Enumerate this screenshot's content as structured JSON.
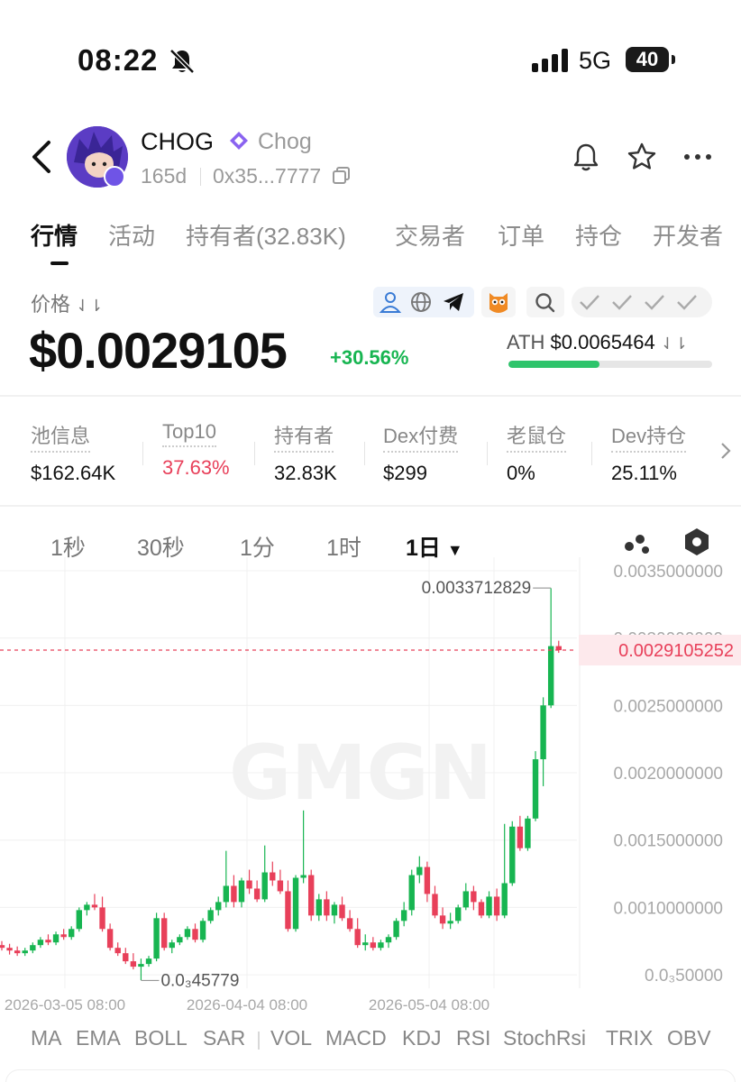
{
  "status_bar": {
    "time": "08:22",
    "network": "5G",
    "battery": "40"
  },
  "header": {
    "symbol": "CHOG",
    "name": "Chog",
    "age": "165d",
    "address": "0x35...7777",
    "icons": [
      "back-icon",
      "bell-icon",
      "star-icon",
      "more-icon",
      "copy-icon",
      "verified-icon"
    ]
  },
  "tabs": [
    "行情",
    "活动",
    "持有者(32.83K)",
    "交易者",
    "订单",
    "持仓",
    "开发者"
  ],
  "price_section": {
    "label": "价格",
    "price": "$0.0029105",
    "change": "+30.56%",
    "ath_label": "ATH",
    "ath_value": "$0.0065464",
    "ath_progress": 0.445,
    "colors": {
      "up": "#17b551",
      "down": "#e8405a"
    }
  },
  "stats": [
    {
      "label": "池信息",
      "value": "$162.64K",
      "color": "#111111"
    },
    {
      "label": "Top10",
      "value": "37.63%",
      "color": "#e8405a"
    },
    {
      "label": "持有者",
      "value": "32.83K",
      "color": "#111111"
    },
    {
      "label": "Dex付费",
      "value": "$299",
      "color": "#111111"
    },
    {
      "label": "老鼠仓",
      "value": "0%",
      "color": "#111111"
    },
    {
      "label": "Dev持仓",
      "value": "25.11%",
      "color": "#111111"
    }
  ],
  "timeframes": {
    "items": [
      "1秒",
      "30秒",
      "1分",
      "1时",
      "1日"
    ],
    "selected": "1日"
  },
  "chart": {
    "y_ticks": [
      "0.0035000000",
      "0.0030000000",
      "0.0025000000",
      "0.0020000000",
      "0.0015000000",
      "0.0010000000",
      "0.0₃50000"
    ],
    "x_ticks": [
      "2026-03-05 08:00",
      "2026-04-04 08:00",
      "2026-05-04 08:00"
    ],
    "current_price": "0.0029105252",
    "high_label": "0.0033712829",
    "low_label": "0.0₃45779",
    "watermark": "GMGN"
  },
  "indicators": [
    "MA",
    "EMA",
    "BOLL",
    "SAR",
    "VOL",
    "MACD",
    "KDJ",
    "RSI",
    "StochRsi",
    "TRIX",
    "OBV"
  ],
  "chart_data": {
    "type": "candlestick",
    "interval": "1日",
    "x_range": [
      "2026-02-25",
      "2026-05-19"
    ],
    "ylim": [
      0.0004,
      0.0036
    ],
    "grid": true,
    "current_price": 0.0029105252,
    "annotations": [
      {
        "label": "0.0033712829",
        "value": 0.0033712829
      },
      {
        "label": "0.0₃45779",
        "value": 0.00045779
      }
    ],
    "candles": [
      [
        0.00072,
        0.00075,
        0.00068,
        0.0007
      ],
      [
        0.0007,
        0.00073,
        0.00065,
        0.00068
      ],
      [
        0.00068,
        0.00071,
        0.00064,
        0.00066
      ],
      [
        0.00066,
        0.0007,
        0.00064,
        0.00068
      ],
      [
        0.00068,
        0.00074,
        0.00066,
        0.00072
      ],
      [
        0.00072,
        0.00078,
        0.0007,
        0.00076
      ],
      [
        0.00076,
        0.0008,
        0.00072,
        0.00074
      ],
      [
        0.00074,
        0.00082,
        0.00072,
        0.0008
      ],
      [
        0.0008,
        0.00084,
        0.00076,
        0.00078
      ],
      [
        0.00078,
        0.00086,
        0.00076,
        0.00084
      ],
      [
        0.00084,
        0.001,
        0.00082,
        0.00098
      ],
      [
        0.00098,
        0.00104,
        0.00094,
        0.00102
      ],
      [
        0.00102,
        0.0011,
        0.00098,
        0.001
      ],
      [
        0.001,
        0.00108,
        0.00082,
        0.00084
      ],
      [
        0.00084,
        0.00088,
        0.00068,
        0.0007
      ],
      [
        0.0007,
        0.00074,
        0.00064,
        0.00066
      ],
      [
        0.00066,
        0.0007,
        0.00058,
        0.0006
      ],
      [
        0.0006,
        0.00066,
        0.00054,
        0.00056
      ],
      [
        0.00056,
        0.00062,
        0.00046,
        0.00058
      ],
      [
        0.00058,
        0.00064,
        0.00056,
        0.00062
      ],
      [
        0.00062,
        0.00096,
        0.0006,
        0.00092
      ],
      [
        0.00092,
        0.00096,
        0.00068,
        0.0007
      ],
      [
        0.0007,
        0.00076,
        0.00066,
        0.00074
      ],
      [
        0.00074,
        0.0008,
        0.00072,
        0.00078
      ],
      [
        0.00078,
        0.00086,
        0.00076,
        0.00084
      ],
      [
        0.00084,
        0.00088,
        0.00074,
        0.00076
      ],
      [
        0.00076,
        0.00092,
        0.00074,
        0.0009
      ],
      [
        0.0009,
        0.001,
        0.00088,
        0.00098
      ],
      [
        0.00098,
        0.00108,
        0.00094,
        0.00104
      ],
      [
        0.00104,
        0.00142,
        0.001,
        0.00116
      ],
      [
        0.00116,
        0.00124,
        0.001,
        0.00104
      ],
      [
        0.00104,
        0.00122,
        0.001,
        0.0012
      ],
      [
        0.0012,
        0.00128,
        0.0011,
        0.00114
      ],
      [
        0.00114,
        0.0012,
        0.00104,
        0.00106
      ],
      [
        0.00106,
        0.00146,
        0.00104,
        0.00126
      ],
      [
        0.00126,
        0.00134,
        0.00116,
        0.0012
      ],
      [
        0.0012,
        0.00128,
        0.0011,
        0.00112
      ],
      [
        0.00112,
        0.0012,
        0.00082,
        0.00084
      ],
      [
        0.00084,
        0.00124,
        0.00082,
        0.00122
      ],
      [
        0.00122,
        0.00172,
        0.00118,
        0.00124
      ],
      [
        0.00124,
        0.00128,
        0.0009,
        0.00094
      ],
      [
        0.00094,
        0.0011,
        0.0009,
        0.00106
      ],
      [
        0.00106,
        0.00112,
        0.0009,
        0.00094
      ],
      [
        0.00094,
        0.00104,
        0.00088,
        0.00102
      ],
      [
        0.00102,
        0.00108,
        0.0009,
        0.00092
      ],
      [
        0.00092,
        0.00098,
        0.00082,
        0.00084
      ],
      [
        0.00084,
        0.00092,
        0.0007,
        0.00072
      ],
      [
        0.00072,
        0.0008,
        0.00068,
        0.00074
      ],
      [
        0.00074,
        0.00078,
        0.00068,
        0.0007
      ],
      [
        0.0007,
        0.00076,
        0.00068,
        0.00074
      ],
      [
        0.00074,
        0.0008,
        0.0007,
        0.00078
      ],
      [
        0.00078,
        0.00092,
        0.00076,
        0.0009
      ],
      [
        0.0009,
        0.00104,
        0.00086,
        0.00098
      ],
      [
        0.00098,
        0.00128,
        0.00094,
        0.00124
      ],
      [
        0.00124,
        0.00138,
        0.00118,
        0.0013
      ],
      [
        0.0013,
        0.00134,
        0.00104,
        0.0011
      ],
      [
        0.0011,
        0.00116,
        0.00092,
        0.00094
      ],
      [
        0.00094,
        0.001,
        0.00084,
        0.00088
      ],
      [
        0.00088,
        0.00096,
        0.00084,
        0.0009
      ],
      [
        0.0009,
        0.00102,
        0.00088,
        0.001
      ],
      [
        0.001,
        0.00118,
        0.00098,
        0.00112
      ],
      [
        0.00112,
        0.00116,
        0.00098,
        0.00104
      ],
      [
        0.00104,
        0.00106,
        0.00092,
        0.00094
      ],
      [
        0.00094,
        0.00112,
        0.00092,
        0.00108
      ],
      [
        0.00108,
        0.00114,
        0.0009,
        0.00094
      ],
      [
        0.00094,
        0.00162,
        0.00092,
        0.00118
      ],
      [
        0.00118,
        0.00164,
        0.00116,
        0.0016
      ],
      [
        0.0016,
        0.00168,
        0.00142,
        0.00144
      ],
      [
        0.00144,
        0.00168,
        0.00142,
        0.00166
      ],
      [
        0.00166,
        0.00216,
        0.00164,
        0.0021
      ],
      [
        0.0021,
        0.00256,
        0.0019,
        0.0025
      ],
      [
        0.0025,
        0.00337,
        0.00248,
        0.00294
      ],
      [
        0.00294,
        0.00298,
        0.00289,
        0.00291
      ]
    ]
  }
}
